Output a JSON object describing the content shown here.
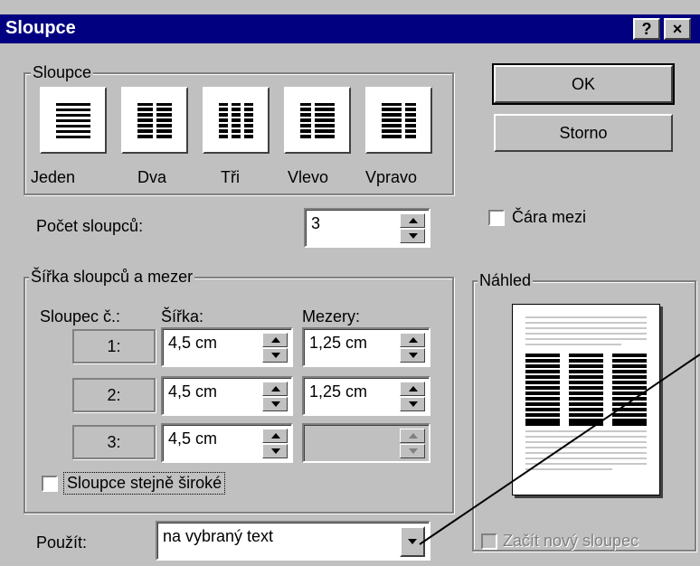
{
  "window": {
    "title": "Sloupce",
    "help_button": "?",
    "close_button": "×"
  },
  "presets_group": {
    "legend": "Sloupce",
    "items": [
      {
        "label": "Jeden",
        "icon": "one-column-icon"
      },
      {
        "label": "Dva",
        "icon": "two-columns-icon"
      },
      {
        "label": "Tři",
        "icon": "three-columns-icon"
      },
      {
        "label": "Vlevo",
        "icon": "left-column-icon"
      },
      {
        "label": "Vpravo",
        "icon": "right-column-icon"
      }
    ]
  },
  "buttons": {
    "ok": "OK",
    "cancel": "Storno"
  },
  "count": {
    "label": "Počet sloupců:",
    "value": "3"
  },
  "line_between": {
    "label": "Čára mezi",
    "checked": false
  },
  "width_group": {
    "legend": "Šířka sloupců a mezer",
    "col_header": "Sloupec č.:",
    "width_header": "Šířka:",
    "spacing_header": "Mezery:",
    "rows": [
      {
        "num": "1:",
        "width": "4,5 cm",
        "spacing": "1,25 cm"
      },
      {
        "num": "2:",
        "width": "4,5 cm",
        "spacing": "1,25 cm"
      },
      {
        "num": "3:",
        "width": "4,5 cm",
        "spacing": ""
      }
    ],
    "equal_width": {
      "label": "Sloupce stejně široké",
      "checked": false
    }
  },
  "preview": {
    "legend": "Náhled"
  },
  "apply": {
    "label": "Použít:",
    "value": "na vybraný text"
  },
  "new_column": {
    "label": "Začít nový sloupec",
    "checked": false,
    "enabled": false
  }
}
